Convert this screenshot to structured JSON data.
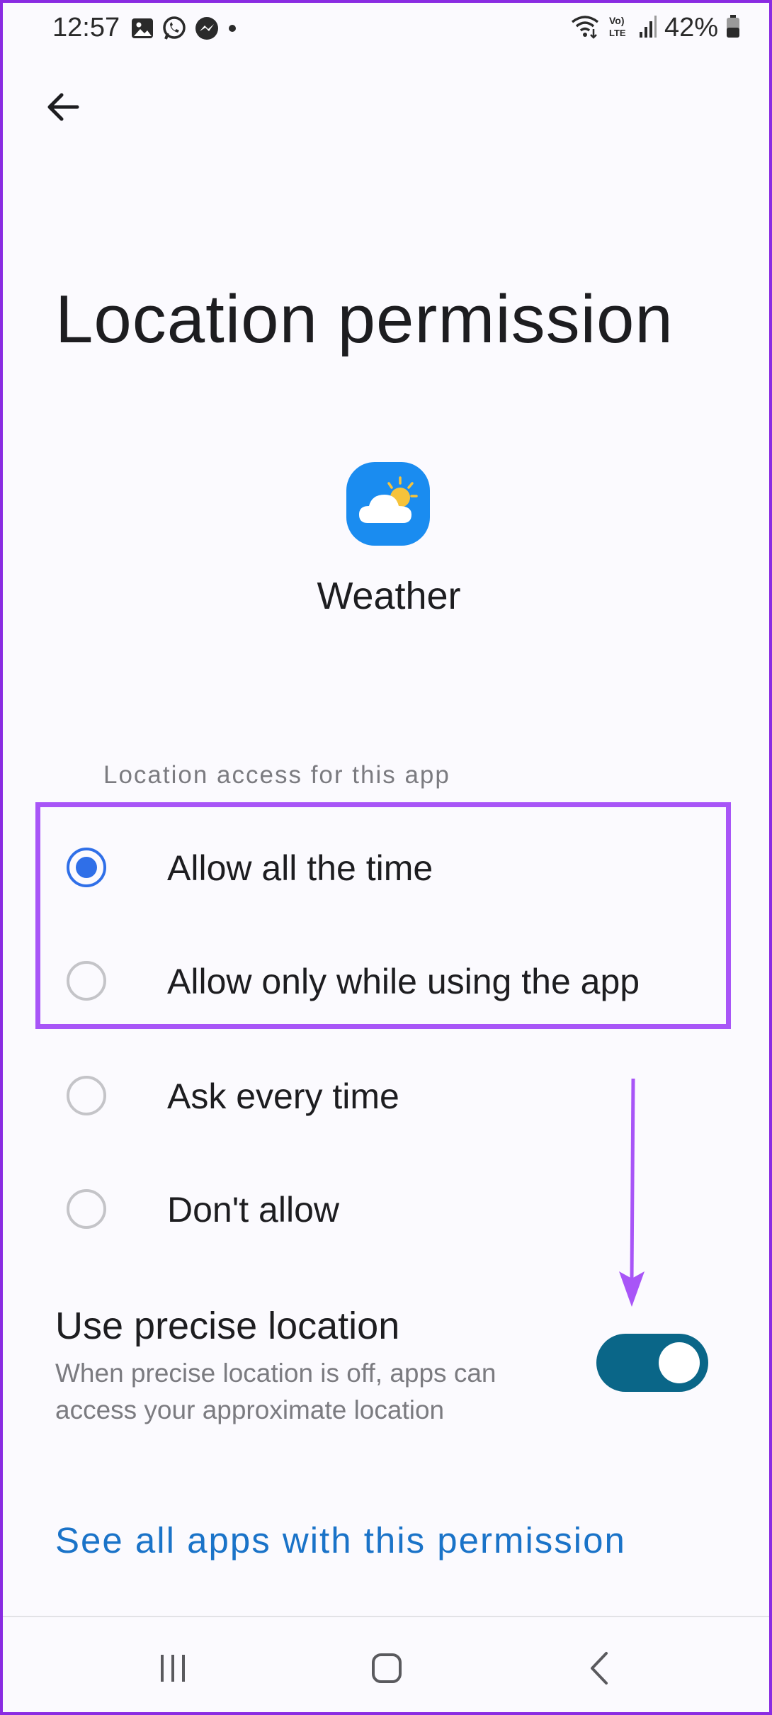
{
  "status_bar": {
    "time": "12:57",
    "battery": "42%",
    "left_icons": [
      "gallery-icon",
      "whatsapp-icon",
      "messenger-icon",
      "dot-icon"
    ],
    "right_icons": [
      "wifi-icon",
      "volte-icon",
      "signal-icon",
      "battery-icon"
    ]
  },
  "header": {
    "back_icon": "arrow-left-icon"
  },
  "page": {
    "title": "Location permission"
  },
  "app": {
    "name": "Weather",
    "icon": "weather-app-icon",
    "icon_color": "#1a8cf0"
  },
  "section": {
    "header": "Location access for this app"
  },
  "options": [
    {
      "label": "Allow all the time",
      "checked": true
    },
    {
      "label": "Allow only while using the app",
      "checked": false
    },
    {
      "label": "Ask every time",
      "checked": false
    },
    {
      "label": "Don't allow",
      "checked": false
    }
  ],
  "precise": {
    "title": "Use precise location",
    "description": "When precise location is off, apps can access your approximate location",
    "enabled": true
  },
  "link": {
    "text": "See all apps with this permission"
  },
  "annotation": {
    "highlight_color": "#a855f7"
  },
  "colors": {
    "accent": "#2f6fe8",
    "toggle_on": "#0a6688",
    "link": "#1a73c8"
  }
}
